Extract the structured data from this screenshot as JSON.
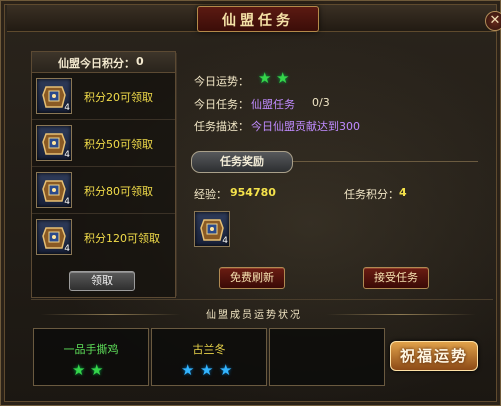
{
  "window": {
    "title": "仙盟任务",
    "close_glyph": "✕"
  },
  "left": {
    "header_label": "仙盟今日积分：",
    "header_value": "0",
    "rewards": [
      {
        "label": "积分20可领取",
        "icon": "chest-icon",
        "count": "4"
      },
      {
        "label": "积分50可领取",
        "icon": "chest-icon",
        "count": "4"
      },
      {
        "label": "积分80可领取",
        "icon": "chest-icon",
        "count": "4"
      },
      {
        "label": "积分120可领取",
        "icon": "chest-icon",
        "count": "4"
      }
    ],
    "claim_button": "领取"
  },
  "info": {
    "fortune_label": "今日运势：",
    "fortune_stars": 2,
    "task_label": "今日任务：",
    "task_link": "仙盟任务",
    "task_progress": "0/3",
    "desc_label": "任务描述：",
    "desc_text": "今日仙盟贡献达到300"
  },
  "rewards_section": {
    "title": "任务奖励",
    "exp_label": "经验：",
    "exp_value": "954780",
    "points_label": "任务积分：",
    "points_value": "4",
    "item_icon": "chest-icon",
    "item_count": "4"
  },
  "buttons": {
    "free_refresh": "免费刷新",
    "accept": "接受任务",
    "bless": "祝福运势"
  },
  "members": {
    "banner": "仙盟成员运势状况",
    "list": [
      {
        "name": "一品手撕鸡",
        "stars": 2,
        "star_color": "green"
      },
      {
        "name": "古兰冬",
        "stars": 3,
        "star_color": "blue"
      },
      {
        "name": "",
        "stars": 0,
        "star_color": ""
      }
    ]
  },
  "colors": {
    "accent_gold": "#f4e24b",
    "link_purple": "#c08bff",
    "star_green": "#35d54a",
    "star_blue": "#33b4ff"
  }
}
